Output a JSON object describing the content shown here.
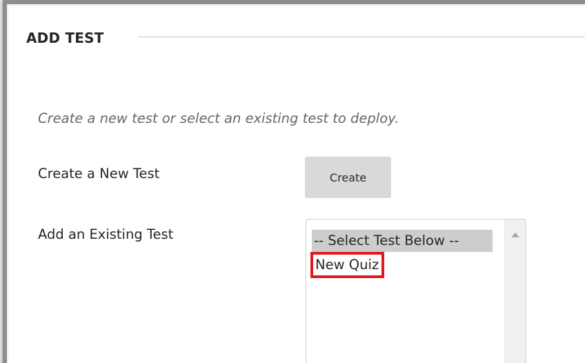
{
  "section": {
    "title": "ADD TEST"
  },
  "instructions": "Create a new test or select an existing test to deploy.",
  "create_row": {
    "label": "Create a New Test",
    "button_label": "Create"
  },
  "existing_row": {
    "label": "Add an Existing Test",
    "options": [
      "-- Select Test Below --",
      "New Quiz"
    ],
    "selected_option": "-- Select Test Below --",
    "highlighted_option": "New Quiz"
  },
  "colors": {
    "highlight_box": "#e0191f",
    "selected_option_bg": "#cdcdcd",
    "button_bg": "#d9d9d9"
  },
  "icons": {
    "scroll_up": "triangle-up"
  }
}
